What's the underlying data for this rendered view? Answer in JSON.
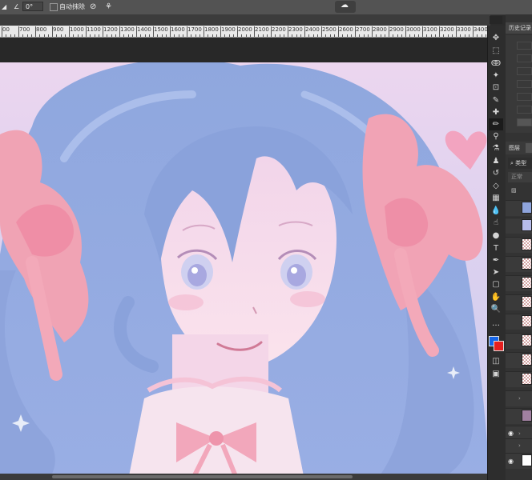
{
  "options_bar": {
    "angle_value": "0°",
    "auto_erase_label": "自动抹除"
  },
  "ruler": {
    "ticks": [
      "00",
      "700",
      "800",
      "900",
      "1000",
      "1100",
      "1200",
      "1300",
      "1400",
      "1500",
      "1600",
      "1700",
      "1800",
      "1900",
      "2000",
      "2100",
      "2200",
      "2300",
      "2400",
      "2500",
      "2600",
      "2700",
      "2800",
      "2900",
      "3000",
      "3100",
      "3200",
      "3300",
      "3400",
      "35"
    ]
  },
  "panels": {
    "history_title": "历史记录",
    "layers_title": "图层",
    "filter_label": "类型",
    "blend_mode": "正常"
  },
  "colors": {
    "foreground": "#1565e8",
    "background": "#e61e1e"
  }
}
